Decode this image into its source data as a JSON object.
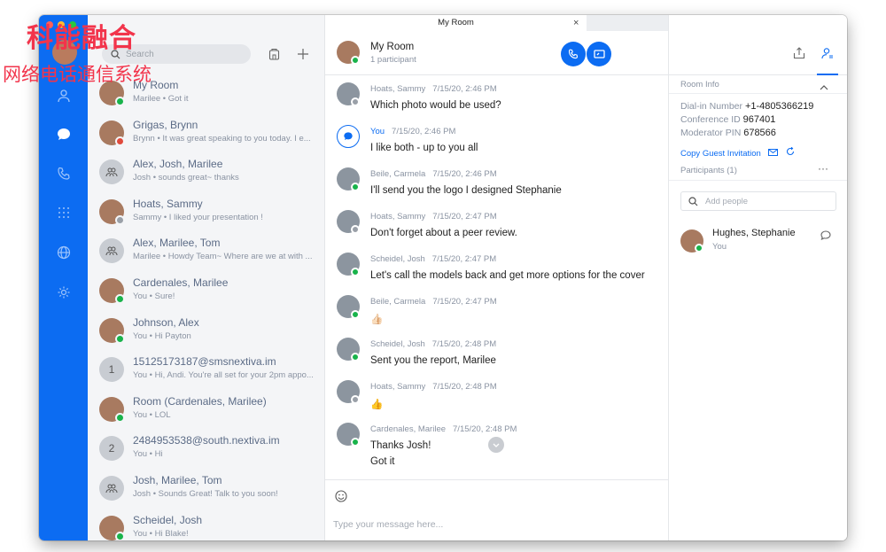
{
  "watermark": {
    "line1": "科能融合",
    "line2": "网络电话通信系统"
  },
  "colors": {
    "accent": "#0c6cf2",
    "online": "#19b34b",
    "busy": "#e04a3c",
    "offline": "#9aa0a8"
  },
  "rail": {
    "icons": [
      "user-icon",
      "chat-icon",
      "phone-icon",
      "dialpad-icon",
      "globe-icon",
      "gear-icon"
    ]
  },
  "sidebar": {
    "search_placeholder": "Search",
    "conversations": [
      {
        "name": "My Room",
        "preview": "Marilee • Got it",
        "status": "online",
        "avatar": "photo"
      },
      {
        "name": "Grigas, Brynn",
        "preview": "Brynn • It was great speaking to you today. I e...",
        "status": "busy",
        "avatar": "photo"
      },
      {
        "name": "Alex, Josh, Marilee",
        "preview": "Josh • sounds great~ thanks",
        "status": "",
        "avatar": "group"
      },
      {
        "name": "Hoats, Sammy",
        "preview": "Sammy • I liked your presentation !",
        "status": "offline",
        "avatar": "photo"
      },
      {
        "name": "Alex, Marilee, Tom",
        "preview": "Marilee • Howdy Team~ Where are we at with ...",
        "status": "",
        "avatar": "group"
      },
      {
        "name": "Cardenales, Marilee",
        "preview": "You • Sure!",
        "status": "online",
        "avatar": "photo"
      },
      {
        "name": "Johnson, Alex",
        "preview": "You • Hi Payton",
        "status": "online",
        "avatar": "photo"
      },
      {
        "name": "15125173187@smsnextiva.im",
        "preview": "You • Hi, Andi. You're all set for your 2pm appo...",
        "status": "",
        "avatar": "1"
      },
      {
        "name": "Room (Cardenales, Marilee)",
        "preview": "You • LOL",
        "status": "online",
        "avatar": "photo"
      },
      {
        "name": "2484953538@south.nextiva.im",
        "preview": "You • Hi",
        "status": "",
        "avatar": "2"
      },
      {
        "name": "Josh, Marilee, Tom",
        "preview": "Josh • Sounds Great! Talk to you soon!",
        "status": "",
        "avatar": "group"
      },
      {
        "name": "Scheidel, Josh",
        "preview": "You • Hi Blake!",
        "status": "online",
        "avatar": "photo"
      }
    ]
  },
  "chat": {
    "tab_title": "My Room",
    "tab_close": "×",
    "header_title": "My Room",
    "header_sub": "1 participant",
    "messages": [
      {
        "who": "Hoats, Sammy",
        "time": "7/15/20, 2:46 PM",
        "text": "Which photo would be used?",
        "status": "offline",
        "me": false
      },
      {
        "who": "You",
        "time": "7/15/20, 2:46 PM",
        "text": "I like both - up to you all",
        "status": "",
        "me": true
      },
      {
        "who": "Beile, Carmela",
        "time": "7/15/20, 2:46 PM",
        "text": "I'll send you the logo I designed Stephanie",
        "status": "online",
        "me": false
      },
      {
        "who": "Hoats, Sammy",
        "time": "7/15/20, 2:47 PM",
        "text": "Don't forget about a peer review.",
        "status": "offline",
        "me": false
      },
      {
        "who": "Scheidel, Josh",
        "time": "7/15/20, 2:47 PM",
        "text": "Let's call the models back and get more options for the cover",
        "status": "online",
        "me": false
      },
      {
        "who": "Beile, Carmela",
        "time": "7/15/20, 2:47 PM",
        "text": "👍🏻",
        "status": "online",
        "me": false
      },
      {
        "who": "Scheidel, Josh",
        "time": "7/15/20, 2:48 PM",
        "text": "Sent you the report, Marilee",
        "status": "online",
        "me": false
      },
      {
        "who": "Hoats, Sammy",
        "time": "7/15/20, 2:48 PM",
        "text": "👍",
        "status": "offline",
        "me": false
      },
      {
        "who": "Cardenales, Marilee",
        "time": "7/15/20, 2:48 PM",
        "text": "Thanks Josh!",
        "text2": "Got it",
        "status": "online",
        "me": false
      }
    ],
    "composer_placeholder": "Type your message here..."
  },
  "info": {
    "room_info_title": "Room Info",
    "dialin_label": "Dial-in Number",
    "dialin_value": "+1-4805366219",
    "conf_label": "Conference ID",
    "conf_value": "967401",
    "pin_label": "Moderator PIN",
    "pin_value": "678566",
    "copy_link": "Copy Guest Invitation",
    "participants_title": "Participants (1)",
    "more": "···",
    "add_people_placeholder": "Add people",
    "participant_name": "Hughes, Stephanie",
    "participant_role": "You"
  }
}
